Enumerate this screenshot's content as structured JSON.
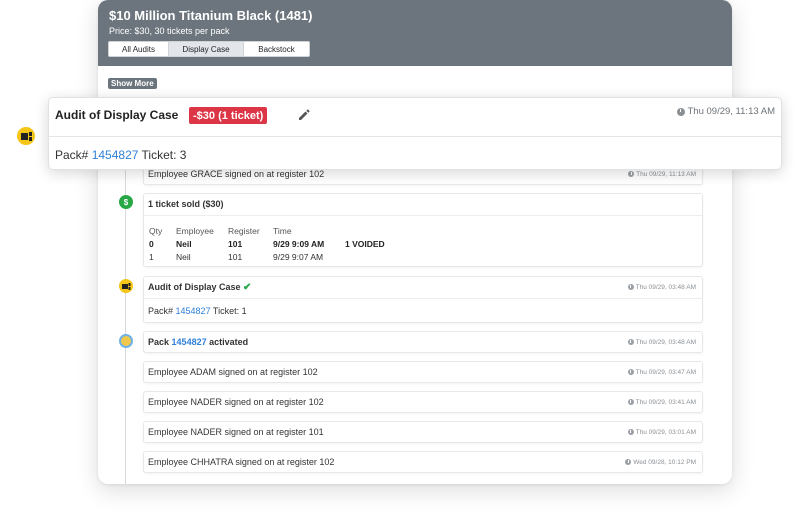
{
  "header": {
    "title": "$10 Million Titanium Black (1481)",
    "subtitle": "Price: $30, 30 tickets per pack",
    "tabs": [
      {
        "label": "All Audits"
      },
      {
        "label": "Display Case"
      },
      {
        "label": "Backstock"
      }
    ],
    "active_tab": "Display Case"
  },
  "show_more_label": "Show More",
  "popout": {
    "title": "Audit of Display Case",
    "badge": "-$30 (1 ticket)",
    "timestamp": "Thu 09/29, 11:13 AM",
    "pack_prefix": "Pack#",
    "pack_number": "1454827",
    "ticket_text": "Ticket: 3"
  },
  "timeline": {
    "grace": {
      "text": "Employee GRACE signed on at register 102",
      "time": "Thu 09/29, 11:13 AM"
    },
    "sold": {
      "title": "1 ticket sold ($30)",
      "headers": [
        "Qty",
        "Employee",
        "Register",
        "Time"
      ],
      "rows": [
        {
          "qty": "0",
          "employee": "Neil",
          "register": "101",
          "time": "9/29 9:09 AM",
          "note": "1 VOIDED"
        },
        {
          "qty": "1",
          "employee": "Neil",
          "register": "101",
          "time": "9/29 9:07 AM",
          "note": ""
        }
      ]
    },
    "audit": {
      "title": "Audit of Display Case",
      "time": "Thu 09/29, 03:48 AM",
      "pack_prefix": "Pack#",
      "pack_number": "1454827",
      "ticket_text": "Ticket: 1"
    },
    "activated": {
      "prefix": "Pack",
      "pack_number": "1454827",
      "suffix": "activated",
      "time": "Thu 09/29, 03:48 AM"
    },
    "signons": [
      {
        "text": "Employee ADAM signed on at register 102",
        "time": "Thu 09/29, 03:47 AM"
      },
      {
        "text": "Employee NADER signed on at register 102",
        "time": "Thu 09/29, 03:41 AM"
      },
      {
        "text": "Employee NADER signed on at register 101",
        "time": "Thu 09/29, 03:01 AM"
      },
      {
        "text": "Employee CHHATRA signed on at register 102",
        "time": "Wed 09/28, 10:12 PM"
      }
    ]
  },
  "colors": {
    "header": "#6c757d",
    "badge": "#dc3545",
    "link": "#2f7fd8",
    "success": "#28a745",
    "tag": "#f5c518"
  },
  "icons": [
    "clock-icon",
    "pencil-icon",
    "dollar-icon",
    "ticket-tag-icon",
    "check-icon",
    "activation-burst-icon"
  ]
}
